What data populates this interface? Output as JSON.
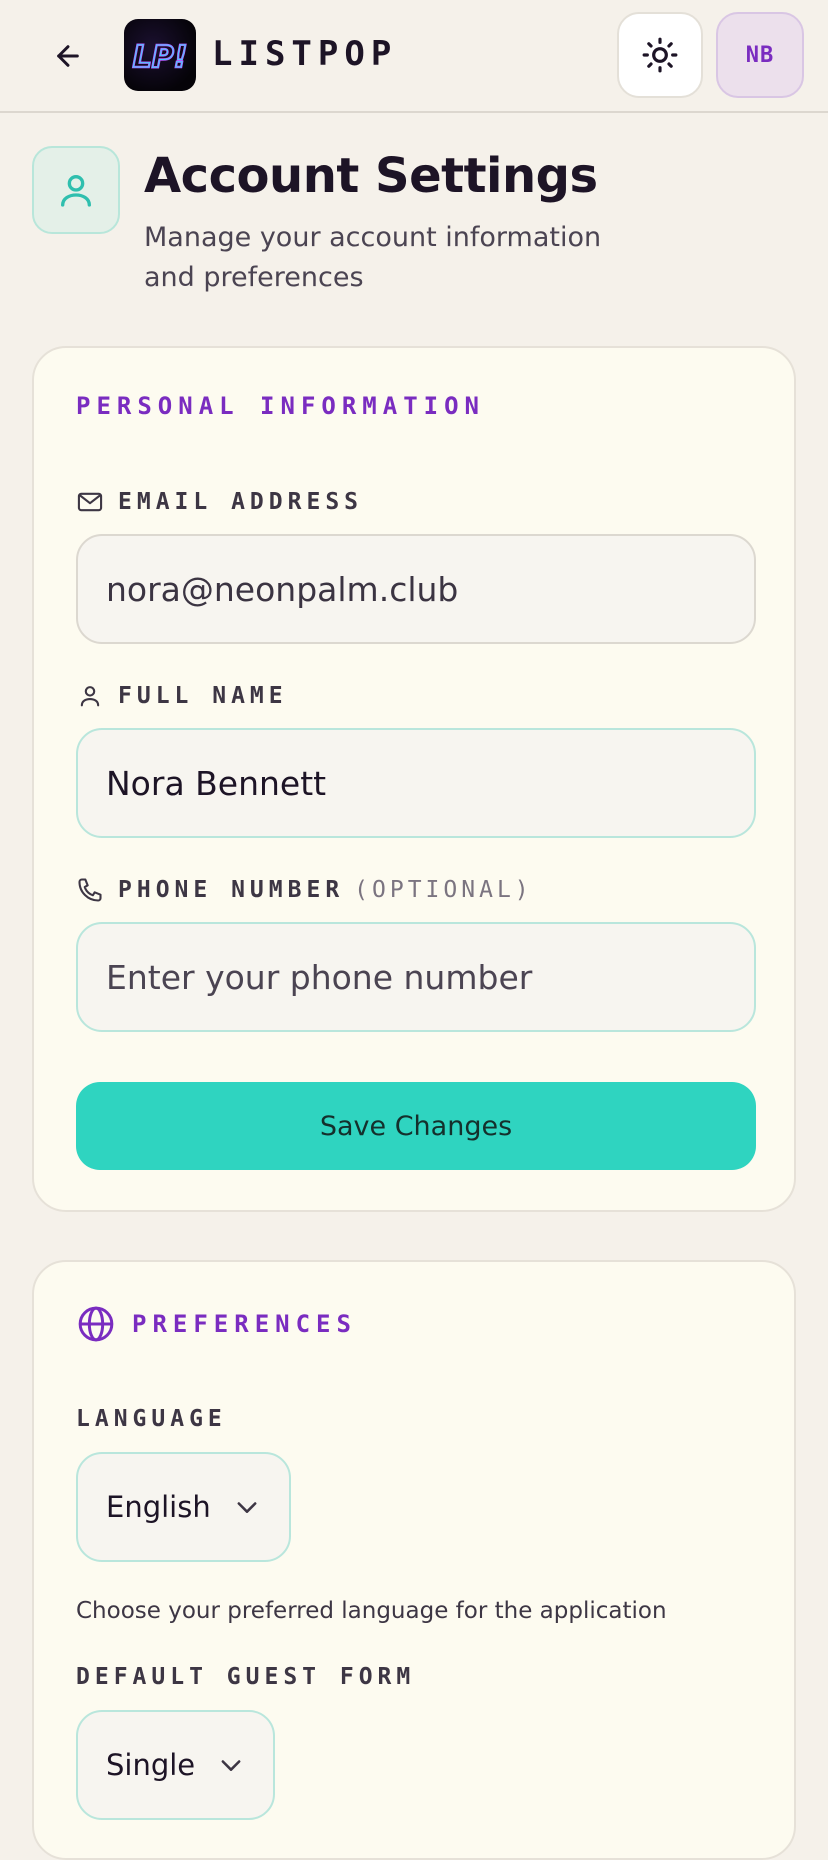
{
  "header": {
    "brand": "LISTPOP",
    "logo_text": "LP!",
    "avatar_initials": "NB"
  },
  "page": {
    "title": "Account Settings",
    "subtitle": "Manage your account information and preferences"
  },
  "personal": {
    "heading": "PERSONAL INFORMATION",
    "email_label": "EMAIL ADDRESS",
    "email_value": "nora@neonpalm.club",
    "name_label": "FULL NAME",
    "name_value": "Nora Bennett",
    "phone_label": "PHONE NUMBER",
    "phone_optional": "(OPTIONAL)",
    "phone_placeholder": "Enter your phone number",
    "save_label": "Save Changes"
  },
  "preferences": {
    "heading": "PREFERENCES",
    "language_label": "LANGUAGE",
    "language_value": "English",
    "language_help": "Choose your preferred language for the application",
    "guest_form_label": "DEFAULT GUEST FORM",
    "guest_form_value": "Single"
  },
  "colors": {
    "accent_purple": "#7a2cc0",
    "accent_teal": "#2fd4c0",
    "background": "#f5f1ea"
  },
  "icons": {
    "back": "arrow-left-icon",
    "theme": "sun-icon",
    "title": "user-icon",
    "email": "mail-icon",
    "name": "user-icon",
    "phone": "phone-icon",
    "preferences": "globe-icon",
    "select": "chevron-down-icon"
  }
}
